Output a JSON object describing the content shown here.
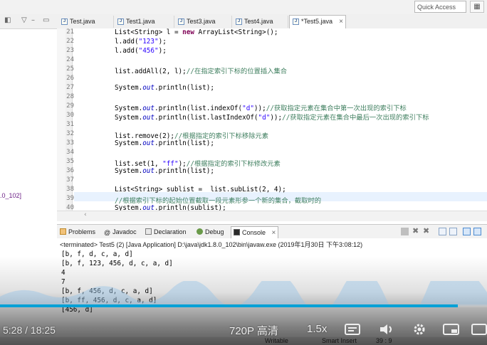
{
  "quick_access": {
    "placeholder": "Quick Access"
  },
  "left_pane": {
    "label": ".0_102]"
  },
  "tabs": [
    {
      "label": "Test.java"
    },
    {
      "label": "Test1.java"
    },
    {
      "label": "Test3.java"
    },
    {
      "label": "Test4.java"
    },
    {
      "label": "*Test5.java",
      "close": "×"
    }
  ],
  "editor": {
    "lines": [
      {
        "n": "21",
        "segs": [
          {
            "t": "List<String> l = "
          },
          {
            "t": "new",
            "c": "kw"
          },
          {
            "t": " ArrayList<String>();"
          }
        ]
      },
      {
        "n": "22",
        "segs": [
          {
            "t": "l.add("
          },
          {
            "t": "\"123\"",
            "c": "str"
          },
          {
            "t": ");"
          }
        ]
      },
      {
        "n": "23",
        "segs": [
          {
            "t": "l.add("
          },
          {
            "t": "\"456\"",
            "c": "str"
          },
          {
            "t": ");"
          }
        ]
      },
      {
        "n": "24",
        "segs": []
      },
      {
        "n": "25",
        "segs": [
          {
            "t": "list.addAll(2, l);"
          },
          {
            "t": "//在指定索引下标的位置插入集合",
            "c": "cm"
          }
        ]
      },
      {
        "n": "26",
        "segs": []
      },
      {
        "n": "27",
        "segs": [
          {
            "t": "System."
          },
          {
            "t": "out",
            "c": "fld"
          },
          {
            "t": ".println(list);"
          }
        ]
      },
      {
        "n": "28",
        "segs": []
      },
      {
        "n": "29",
        "segs": [
          {
            "t": "System."
          },
          {
            "t": "out",
            "c": "fld"
          },
          {
            "t": ".println(list.indexOf("
          },
          {
            "t": "\"d\"",
            "c": "str"
          },
          {
            "t": "));"
          },
          {
            "t": "//获取指定元素在集合中第一次出现的索引下标",
            "c": "cm"
          }
        ]
      },
      {
        "n": "30",
        "segs": [
          {
            "t": "System."
          },
          {
            "t": "out",
            "c": "fld"
          },
          {
            "t": ".println(list.lastIndexOf("
          },
          {
            "t": "\"d\"",
            "c": "str"
          },
          {
            "t": "));"
          },
          {
            "t": "//获取指定元素在集合中最后一次出现的索引下标",
            "c": "cm"
          }
        ]
      },
      {
        "n": "31",
        "segs": []
      },
      {
        "n": "32",
        "segs": [
          {
            "t": "list.remove(2);"
          },
          {
            "t": "//根据指定的索引下标移除元素",
            "c": "cm"
          }
        ]
      },
      {
        "n": "33",
        "segs": [
          {
            "t": "System."
          },
          {
            "t": "out",
            "c": "fld"
          },
          {
            "t": ".println(list);"
          }
        ]
      },
      {
        "n": "34",
        "segs": []
      },
      {
        "n": "35",
        "segs": [
          {
            "t": "list.set(1, "
          },
          {
            "t": "\"ff\"",
            "c": "str"
          },
          {
            "t": ");"
          },
          {
            "t": "//根据指定的索引下标修改元素",
            "c": "cm"
          }
        ]
      },
      {
        "n": "36",
        "segs": [
          {
            "t": "System."
          },
          {
            "t": "out",
            "c": "fld"
          },
          {
            "t": ".println(list);"
          }
        ]
      },
      {
        "n": "37",
        "segs": []
      },
      {
        "n": "38",
        "segs": [
          {
            "t": "List<String> sublist =  list.subList(2, 4);"
          }
        ]
      },
      {
        "n": "39",
        "segs": [
          {
            "t": "//根据索引下标的起始位置截取一段元素形参一个新的集合，截取时的",
            "c": "cm"
          }
        ]
      },
      {
        "n": "40",
        "segs": [
          {
            "t": "System."
          },
          {
            "t": "out",
            "c": "fld"
          },
          {
            "t": ".println(sublist);"
          }
        ]
      }
    ]
  },
  "views": {
    "problems": "Problems",
    "javadoc": "Javadoc",
    "declaration": "Declaration",
    "debug": "Debug",
    "console": "Console",
    "console_close": "×"
  },
  "console": {
    "terminated": "<terminated> Test5 (2) [Java Application] D:\\java\\jdk1.8.0_102\\bin\\javaw.exe (2019年1月30日 下午3:08:12)",
    "lines": [
      "[b, f, d, c, a, d]",
      "[b, f, 123, 456, d, c, a, d]",
      "4",
      "7",
      "[b, f, 456, d, c, a, d]",
      "[b, ff, 456, d, c, a, d]",
      "[456, d]"
    ]
  },
  "status": {
    "mode": "Writable",
    "insert": "Smart Insert",
    "position": "39 : 9"
  },
  "video": {
    "time": "5:28 / 18:25",
    "quality": "720P 高清",
    "speed": "1.5x",
    "progress": 0.94,
    "accent": "#00a1d6"
  }
}
